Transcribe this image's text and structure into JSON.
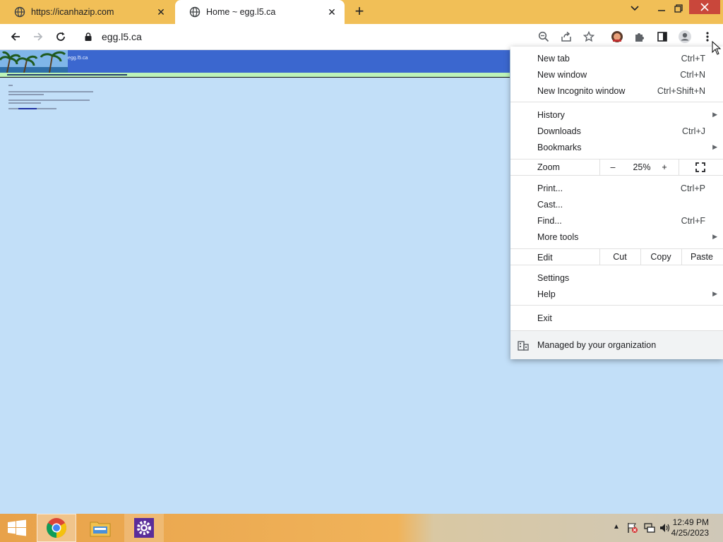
{
  "tabs": [
    {
      "title": "https://icanhazip.com"
    },
    {
      "title": "Home ~ egg.l5.ca"
    }
  ],
  "toolbar": {
    "url": "egg.l5.ca"
  },
  "site": {
    "title": "egg.l5.ca"
  },
  "menu": {
    "new_tab": {
      "label": "New tab",
      "shortcut": "Ctrl+T"
    },
    "new_window": {
      "label": "New window",
      "shortcut": "Ctrl+N"
    },
    "incognito": {
      "label": "New Incognito window",
      "shortcut": "Ctrl+Shift+N"
    },
    "history": {
      "label": "History"
    },
    "downloads": {
      "label": "Downloads",
      "shortcut": "Ctrl+J"
    },
    "bookmarks": {
      "label": "Bookmarks"
    },
    "zoom": {
      "label": "Zoom",
      "minus": "–",
      "value": "25%",
      "plus": "+"
    },
    "print": {
      "label": "Print...",
      "shortcut": "Ctrl+P"
    },
    "cast": {
      "label": "Cast..."
    },
    "find": {
      "label": "Find...",
      "shortcut": "Ctrl+F"
    },
    "more_tools": {
      "label": "More tools"
    },
    "edit": {
      "label": "Edit",
      "cut": "Cut",
      "copy": "Copy",
      "paste": "Paste"
    },
    "settings": {
      "label": "Settings"
    },
    "help": {
      "label": "Help"
    },
    "exit": {
      "label": "Exit"
    },
    "managed": {
      "label": "Managed by your organization"
    }
  },
  "taskbar": {
    "time": "12:49 PM",
    "date": "4/25/2023"
  },
  "colors": {
    "tabstrip": "#f1bf57",
    "page_bg": "#c2dff8",
    "banner": "#3b67cf",
    "close_red": "#c9473b"
  }
}
